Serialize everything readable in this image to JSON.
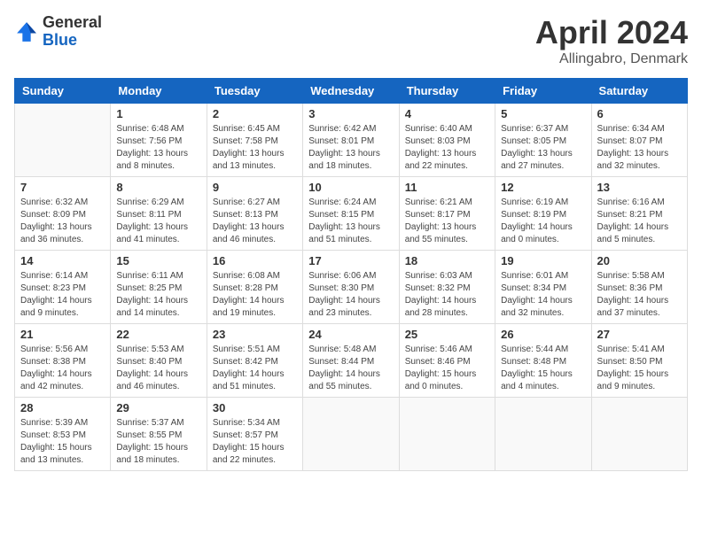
{
  "logo": {
    "general": "General",
    "blue": "Blue"
  },
  "title": "April 2024",
  "subtitle": "Allingabro, Denmark",
  "weekdays": [
    "Sunday",
    "Monday",
    "Tuesday",
    "Wednesday",
    "Thursday",
    "Friday",
    "Saturday"
  ],
  "weeks": [
    [
      {
        "day": "",
        "sunrise": "",
        "sunset": "",
        "daylight": ""
      },
      {
        "day": "1",
        "sunrise": "Sunrise: 6:48 AM",
        "sunset": "Sunset: 7:56 PM",
        "daylight": "Daylight: 13 hours and 8 minutes."
      },
      {
        "day": "2",
        "sunrise": "Sunrise: 6:45 AM",
        "sunset": "Sunset: 7:58 PM",
        "daylight": "Daylight: 13 hours and 13 minutes."
      },
      {
        "day": "3",
        "sunrise": "Sunrise: 6:42 AM",
        "sunset": "Sunset: 8:01 PM",
        "daylight": "Daylight: 13 hours and 18 minutes."
      },
      {
        "day": "4",
        "sunrise": "Sunrise: 6:40 AM",
        "sunset": "Sunset: 8:03 PM",
        "daylight": "Daylight: 13 hours and 22 minutes."
      },
      {
        "day": "5",
        "sunrise": "Sunrise: 6:37 AM",
        "sunset": "Sunset: 8:05 PM",
        "daylight": "Daylight: 13 hours and 27 minutes."
      },
      {
        "day": "6",
        "sunrise": "Sunrise: 6:34 AM",
        "sunset": "Sunset: 8:07 PM",
        "daylight": "Daylight: 13 hours and 32 minutes."
      }
    ],
    [
      {
        "day": "7",
        "sunrise": "Sunrise: 6:32 AM",
        "sunset": "Sunset: 8:09 PM",
        "daylight": "Daylight: 13 hours and 36 minutes."
      },
      {
        "day": "8",
        "sunrise": "Sunrise: 6:29 AM",
        "sunset": "Sunset: 8:11 PM",
        "daylight": "Daylight: 13 hours and 41 minutes."
      },
      {
        "day": "9",
        "sunrise": "Sunrise: 6:27 AM",
        "sunset": "Sunset: 8:13 PM",
        "daylight": "Daylight: 13 hours and 46 minutes."
      },
      {
        "day": "10",
        "sunrise": "Sunrise: 6:24 AM",
        "sunset": "Sunset: 8:15 PM",
        "daylight": "Daylight: 13 hours and 51 minutes."
      },
      {
        "day": "11",
        "sunrise": "Sunrise: 6:21 AM",
        "sunset": "Sunset: 8:17 PM",
        "daylight": "Daylight: 13 hours and 55 minutes."
      },
      {
        "day": "12",
        "sunrise": "Sunrise: 6:19 AM",
        "sunset": "Sunset: 8:19 PM",
        "daylight": "Daylight: 14 hours and 0 minutes."
      },
      {
        "day": "13",
        "sunrise": "Sunrise: 6:16 AM",
        "sunset": "Sunset: 8:21 PM",
        "daylight": "Daylight: 14 hours and 5 minutes."
      }
    ],
    [
      {
        "day": "14",
        "sunrise": "Sunrise: 6:14 AM",
        "sunset": "Sunset: 8:23 PM",
        "daylight": "Daylight: 14 hours and 9 minutes."
      },
      {
        "day": "15",
        "sunrise": "Sunrise: 6:11 AM",
        "sunset": "Sunset: 8:25 PM",
        "daylight": "Daylight: 14 hours and 14 minutes."
      },
      {
        "day": "16",
        "sunrise": "Sunrise: 6:08 AM",
        "sunset": "Sunset: 8:28 PM",
        "daylight": "Daylight: 14 hours and 19 minutes."
      },
      {
        "day": "17",
        "sunrise": "Sunrise: 6:06 AM",
        "sunset": "Sunset: 8:30 PM",
        "daylight": "Daylight: 14 hours and 23 minutes."
      },
      {
        "day": "18",
        "sunrise": "Sunrise: 6:03 AM",
        "sunset": "Sunset: 8:32 PM",
        "daylight": "Daylight: 14 hours and 28 minutes."
      },
      {
        "day": "19",
        "sunrise": "Sunrise: 6:01 AM",
        "sunset": "Sunset: 8:34 PM",
        "daylight": "Daylight: 14 hours and 32 minutes."
      },
      {
        "day": "20",
        "sunrise": "Sunrise: 5:58 AM",
        "sunset": "Sunset: 8:36 PM",
        "daylight": "Daylight: 14 hours and 37 minutes."
      }
    ],
    [
      {
        "day": "21",
        "sunrise": "Sunrise: 5:56 AM",
        "sunset": "Sunset: 8:38 PM",
        "daylight": "Daylight: 14 hours and 42 minutes."
      },
      {
        "day": "22",
        "sunrise": "Sunrise: 5:53 AM",
        "sunset": "Sunset: 8:40 PM",
        "daylight": "Daylight: 14 hours and 46 minutes."
      },
      {
        "day": "23",
        "sunrise": "Sunrise: 5:51 AM",
        "sunset": "Sunset: 8:42 PM",
        "daylight": "Daylight: 14 hours and 51 minutes."
      },
      {
        "day": "24",
        "sunrise": "Sunrise: 5:48 AM",
        "sunset": "Sunset: 8:44 PM",
        "daylight": "Daylight: 14 hours and 55 minutes."
      },
      {
        "day": "25",
        "sunrise": "Sunrise: 5:46 AM",
        "sunset": "Sunset: 8:46 PM",
        "daylight": "Daylight: 15 hours and 0 minutes."
      },
      {
        "day": "26",
        "sunrise": "Sunrise: 5:44 AM",
        "sunset": "Sunset: 8:48 PM",
        "daylight": "Daylight: 15 hours and 4 minutes."
      },
      {
        "day": "27",
        "sunrise": "Sunrise: 5:41 AM",
        "sunset": "Sunset: 8:50 PM",
        "daylight": "Daylight: 15 hours and 9 minutes."
      }
    ],
    [
      {
        "day": "28",
        "sunrise": "Sunrise: 5:39 AM",
        "sunset": "Sunset: 8:53 PM",
        "daylight": "Daylight: 15 hours and 13 minutes."
      },
      {
        "day": "29",
        "sunrise": "Sunrise: 5:37 AM",
        "sunset": "Sunset: 8:55 PM",
        "daylight": "Daylight: 15 hours and 18 minutes."
      },
      {
        "day": "30",
        "sunrise": "Sunrise: 5:34 AM",
        "sunset": "Sunset: 8:57 PM",
        "daylight": "Daylight: 15 hours and 22 minutes."
      },
      {
        "day": "",
        "sunrise": "",
        "sunset": "",
        "daylight": ""
      },
      {
        "day": "",
        "sunrise": "",
        "sunset": "",
        "daylight": ""
      },
      {
        "day": "",
        "sunrise": "",
        "sunset": "",
        "daylight": ""
      },
      {
        "day": "",
        "sunrise": "",
        "sunset": "",
        "daylight": ""
      }
    ]
  ]
}
